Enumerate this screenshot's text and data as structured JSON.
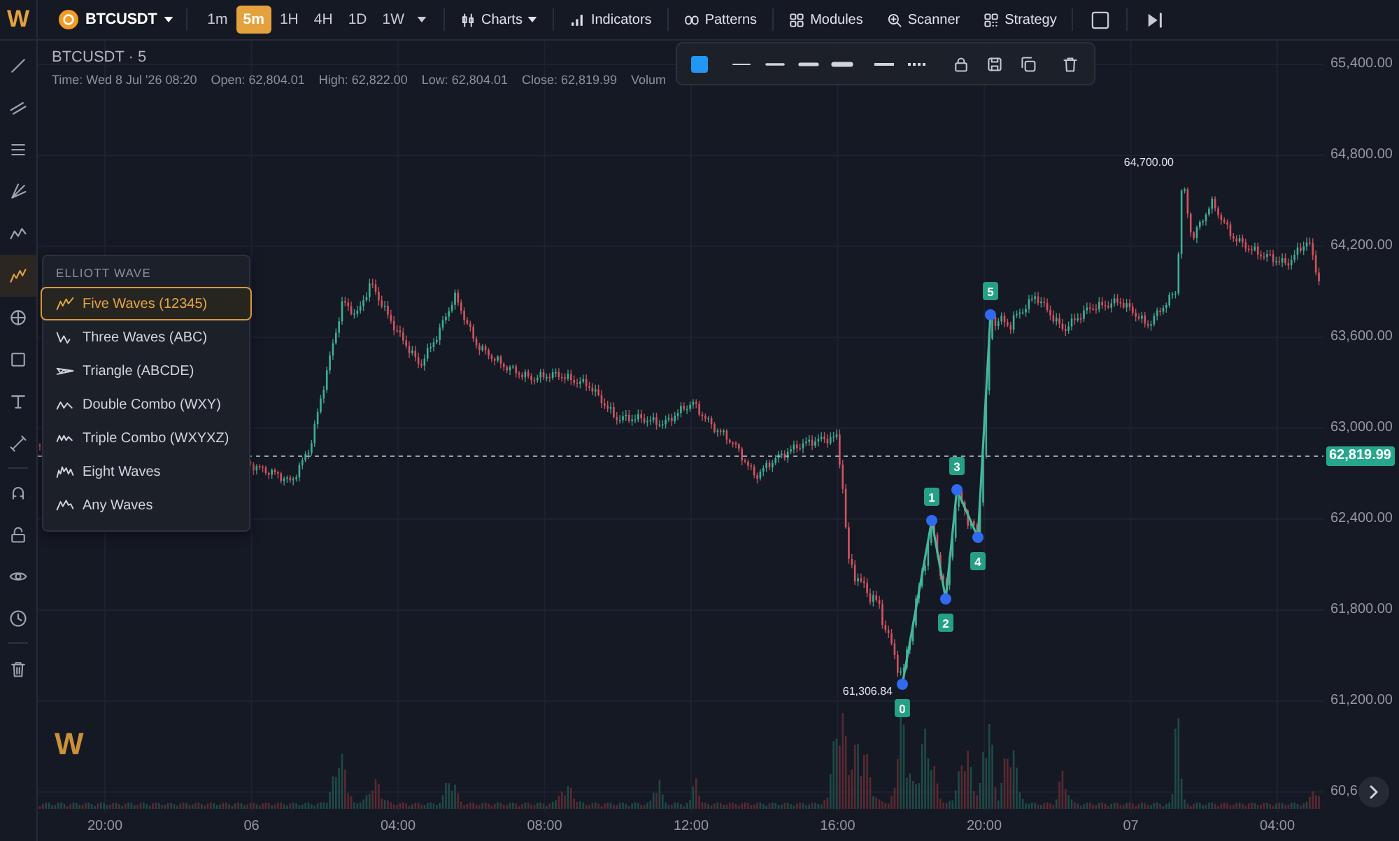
{
  "toolbar": {
    "logo": "W",
    "symbol": "BTCUSDT",
    "timeframes": [
      {
        "label": "1m",
        "selected": false
      },
      {
        "label": "5m",
        "selected": true
      },
      {
        "label": "1H",
        "selected": false
      },
      {
        "label": "4H",
        "selected": false
      },
      {
        "label": "1D",
        "selected": false
      },
      {
        "label": "1W",
        "selected": false
      }
    ],
    "menus": [
      {
        "label": "Charts",
        "dropdown": true
      },
      {
        "label": "Indicators",
        "dropdown": false
      },
      {
        "label": "Patterns",
        "dropdown": false
      },
      {
        "label": "Modules",
        "dropdown": false
      },
      {
        "label": "Scanner",
        "dropdown": false
      },
      {
        "label": "Strategy",
        "dropdown": false
      }
    ]
  },
  "sidebar": {
    "tools": [
      {
        "selected": false
      },
      {
        "selected": false
      },
      {
        "selected": false
      },
      {
        "selected": false
      },
      {
        "selected": false
      },
      {
        "selected": true
      },
      {
        "selected": false
      },
      {
        "selected": false
      },
      {
        "selected": false
      },
      {
        "selected": false
      },
      {
        "selected": false
      },
      {
        "selected": false
      },
      {
        "selected": false
      },
      {
        "selected": false
      },
      {
        "selected": false
      }
    ]
  },
  "legend": {
    "title": "BTCUSDT · 5",
    "fields": [
      "Time: Wed 8 Jul '26 08:20",
      "Open: 62,804.01",
      "High: 62,822.00",
      "Low: 62,804.01",
      "Close: 62,819.99",
      "Volum"
    ]
  },
  "elliott_menu": {
    "title": "ELLIOTT WAVE",
    "items": [
      {
        "label": "Five Waves (12345)",
        "selected": true
      },
      {
        "label": "Three Waves (ABC)",
        "selected": false
      },
      {
        "label": "Triangle (ABCDE)",
        "selected": false
      },
      {
        "label": "Double Combo (WXY)",
        "selected": false
      },
      {
        "label": "Triple Combo (WXYXZ)",
        "selected": false
      },
      {
        "label": "Eight Waves",
        "selected": false
      },
      {
        "label": "Any Waves",
        "selected": false
      }
    ]
  },
  "chart": {
    "high_label": "64,700.00",
    "low_label": "61,306.84",
    "wave_labels": [
      "0",
      "1",
      "2",
      "3",
      "4",
      "5"
    ],
    "logo": "W"
  },
  "price_axis": {
    "labels": [
      "65,400.00",
      "64,800.00",
      "64,200.00",
      "63,600.00",
      "63,000.00",
      "62,400.00",
      "61,800.00",
      "61,200.00",
      "60,6"
    ],
    "last_price": "62,819.99"
  },
  "time_axis": {
    "labels": [
      "20:00",
      "06",
      "04:00",
      "08:00",
      "12:00",
      "16:00",
      "20:00",
      "07",
      "04:00"
    ]
  }
}
